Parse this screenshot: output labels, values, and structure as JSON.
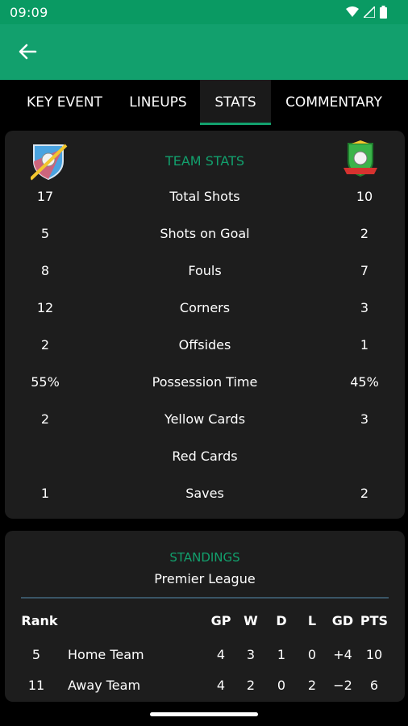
{
  "status_bar": {
    "time": "09:09",
    "icons": [
      "wifi-icon",
      "signal-icon",
      "battery-icon"
    ]
  },
  "app_bar": {
    "back_icon": "back-arrow-icon",
    "color": "#12a06d"
  },
  "tabs": [
    {
      "label": "KEY EVENT",
      "active": false
    },
    {
      "label": "LINEUPS",
      "active": false
    },
    {
      "label": "STATS",
      "active": true
    },
    {
      "label": "COMMENTARY",
      "active": false
    }
  ],
  "team_stats": {
    "header": "TEAM STATS",
    "home_logo": "home-team-crest-icon",
    "away_logo": "away-team-crest-icon",
    "rows": [
      {
        "home": "17",
        "label": "Total Shots",
        "away": "10"
      },
      {
        "home": "5",
        "label": "Shots on Goal",
        "away": "2"
      },
      {
        "home": "8",
        "label": "Fouls",
        "away": "7"
      },
      {
        "home": "12",
        "label": "Corners",
        "away": "3"
      },
      {
        "home": "2",
        "label": "Offsides",
        "away": "1"
      },
      {
        "home": "55%",
        "label": "Possession Time",
        "away": "45%"
      },
      {
        "home": "2",
        "label": "Yellow Cards",
        "away": "3"
      },
      {
        "home": "",
        "label": "Red Cards",
        "away": ""
      },
      {
        "home": "1",
        "label": "Saves",
        "away": "2"
      }
    ]
  },
  "standings": {
    "title": "STANDINGS",
    "league": "Premier League",
    "columns": {
      "rank": "Rank",
      "gp": "GP",
      "w": "W",
      "d": "D",
      "l": "L",
      "gd": "GD",
      "pts": "PTS"
    },
    "rows": [
      {
        "rank": "5",
        "team": "Home Team",
        "gp": "4",
        "w": "3",
        "d": "1",
        "l": "0",
        "gd": "+4",
        "pts": "10"
      },
      {
        "rank": "11",
        "team": "Away Team",
        "gp": "4",
        "w": "2",
        "d": "0",
        "l": "2",
        "gd": "−2",
        "pts": "6"
      }
    ]
  },
  "colors": {
    "accent": "#12a06d",
    "card": "#1d1d1d",
    "background": "#000000"
  }
}
